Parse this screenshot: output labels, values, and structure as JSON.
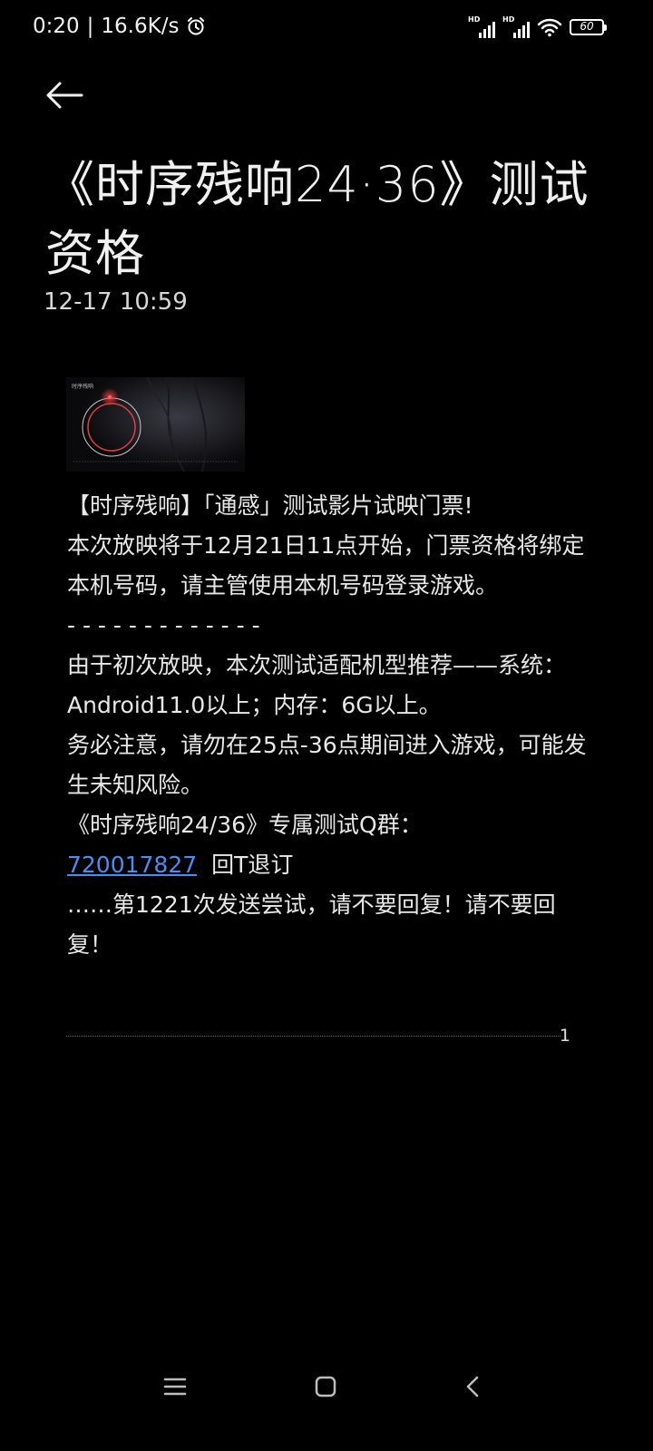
{
  "status_bar": {
    "time": "0:20",
    "separator": "|",
    "net_speed": "16.6K/s",
    "alarm_icon": "alarm-clock-icon",
    "signal_1_label": "HD",
    "signal_2_label": "HD",
    "wifi_icon": "wifi-icon",
    "battery_level": "60",
    "battery_fraction": 0.6
  },
  "header": {
    "back_icon": "arrow-left-icon",
    "title": "《时序残响24·36》测试资格",
    "timestamp": "12-17 10:59"
  },
  "message": {
    "image_alt": "时序残响",
    "lines": [
      "【时序残响】「通感」测试影片试映门票!",
      "本次放映将于12月21日11点开始，门票资格将绑定本机号码，请主管使用本机号码登录游戏。",
      "- - - - - - - - - - - - -",
      "由于初次放映，本次测试适配机型推荐——系统：Android11.0以上；内存：6G以上。",
      "务必注意，请勿在25点-36点期间进入游戏，可能发生未知风险。",
      "《时序残响24/36》专属测试Q群："
    ],
    "group_number": "720017827",
    "unsubscribe_text": "回T退订",
    "closing": "……第1221次发送尝试，请不要回复！请不要回复！",
    "page_count": "1"
  },
  "nav_bar": {
    "menu_icon": "menu-icon",
    "home_icon": "home-icon",
    "back_icon": "back-chevron-icon"
  }
}
